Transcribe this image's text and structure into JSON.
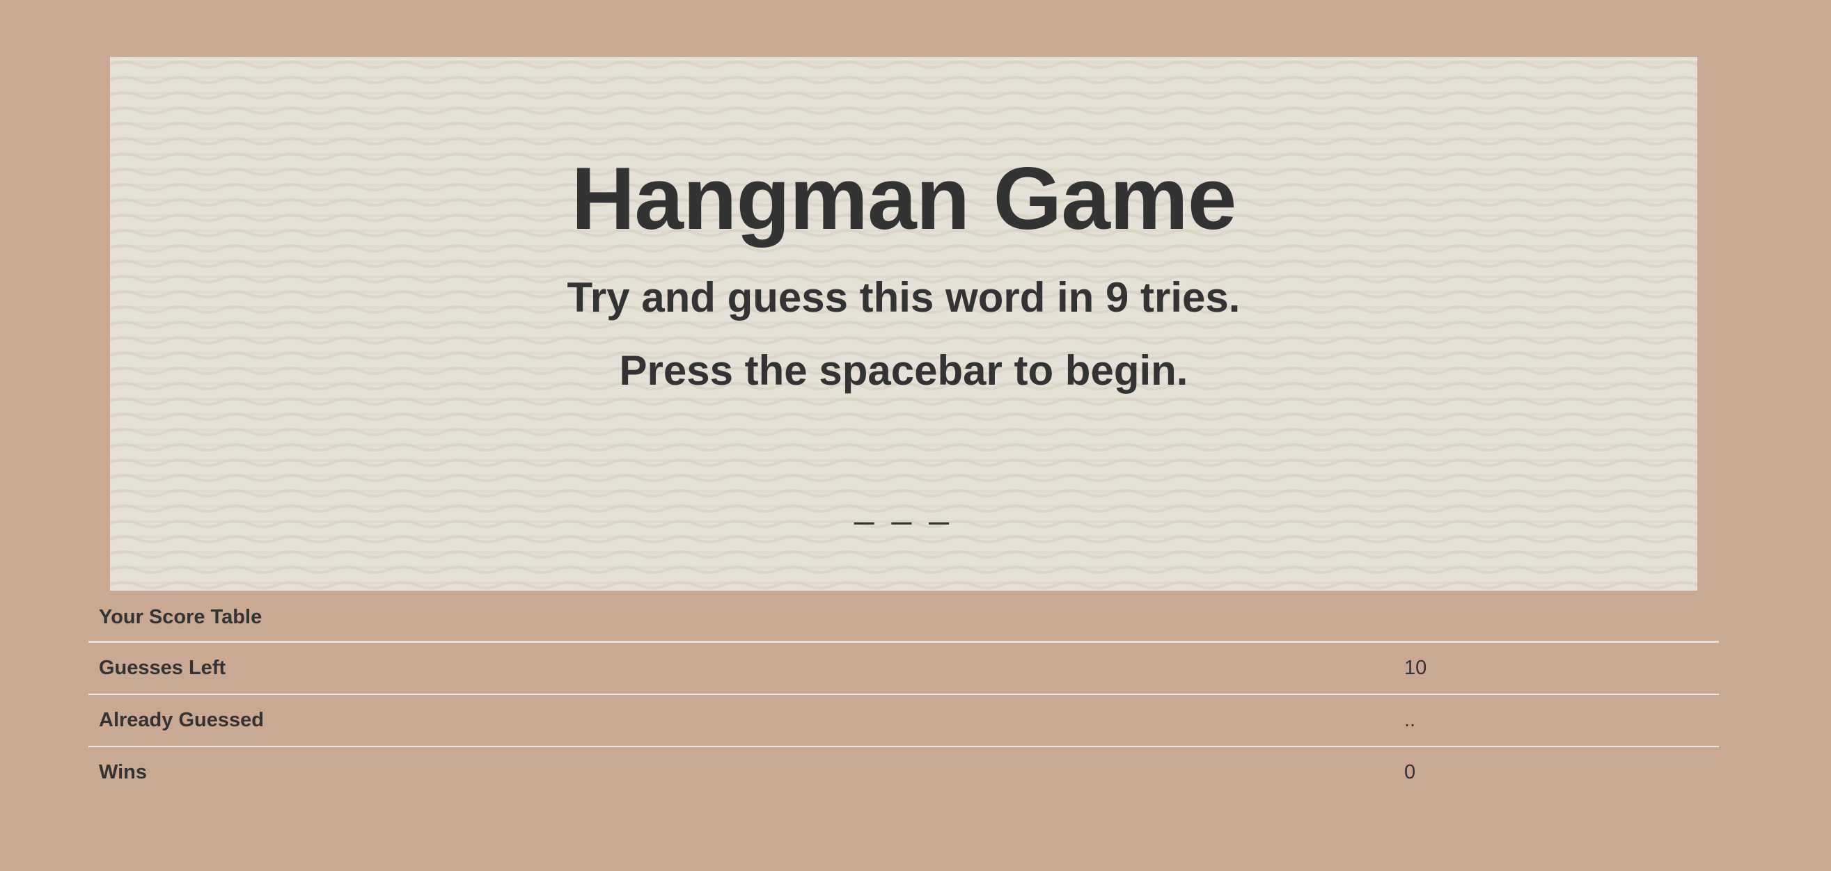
{
  "colors": {
    "page_background": "#caa992",
    "panel_background": "#e6e1d6",
    "text": "#333333"
  },
  "game": {
    "title": "Hangman Game",
    "instruction_tries": "Try and guess this word in 9 tries.",
    "instruction_start": "Press the spacebar to begin.",
    "word_display": "_ _ _"
  },
  "score_table": {
    "header": "Your Score Table",
    "rows": [
      {
        "label": "Guesses Left",
        "value": "10"
      },
      {
        "label": "Already Guessed",
        "value": ".."
      },
      {
        "label": "Wins",
        "value": "0"
      }
    ]
  }
}
